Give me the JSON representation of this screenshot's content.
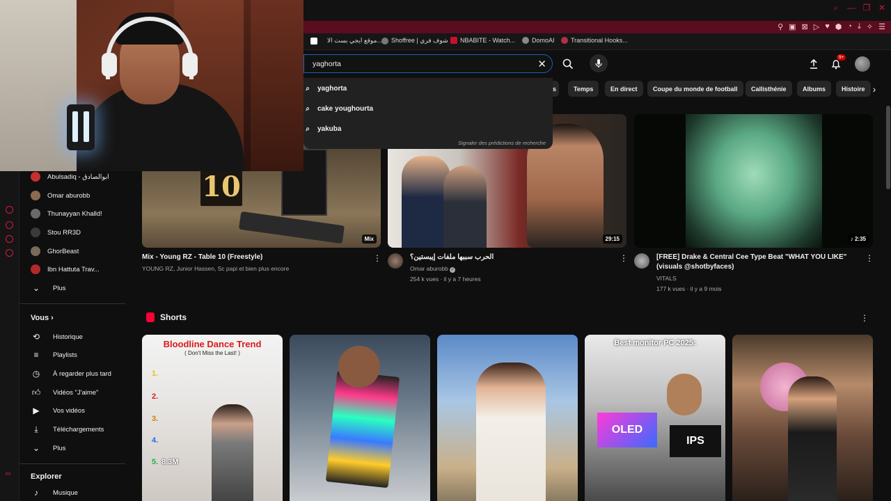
{
  "bookmarks": [
    {
      "label": "موقع ايجي بست الا..."
    },
    {
      "label": "Shoffree | شوف فري"
    },
    {
      "label": "NBABITE - Watch..."
    },
    {
      "label": "DomoAI"
    },
    {
      "label": "Transitional Hooks..."
    }
  ],
  "search": {
    "query": "yaghorta",
    "suggestions": [
      "yaghorta",
      "cake youghourta",
      "yakuba"
    ],
    "report": "Signaler des prédictions de recherche"
  },
  "header": {
    "notif_count": "9+"
  },
  "chips": [
    "Temps",
    "En direct",
    "Coupe du monde de football",
    "Callisthénie",
    "Albums",
    "Histoire"
  ],
  "chip_partial": "s",
  "subscriptions": [
    {
      "name": "Abulsadiq - ابوالصادق",
      "color": "#c43030"
    },
    {
      "name": "Omar aburobb",
      "color": "#8a6a50"
    },
    {
      "name": "Thunayyan Khalld!",
      "color": "#6a6a6a"
    },
    {
      "name": "Stou RR3D",
      "color": "#3a3a3a"
    },
    {
      "name": "GhorBeast",
      "color": "#7a6a5a"
    },
    {
      "name": "Ibn Hattuta Trav...",
      "color": "#b02a2a"
    }
  ],
  "sidebar": {
    "more": "Plus",
    "you_header": "Vous",
    "you_items": [
      "Historique",
      "Playlists",
      "À regarder plus tard",
      "Vidéos \"J'aime\"",
      "Vos vidéos",
      "Téléchargements",
      "Plus"
    ],
    "explore_header": "Explorer",
    "explore_items": [
      "Musique"
    ]
  },
  "videos": [
    {
      "title": "Mix - Young RZ - Table 10 (Freestyle)",
      "meta1": "YOUNG RZ, Junior Hassen, Sc papi et bien plus encore",
      "meta2": "",
      "badge": "Mix",
      "overlay": "10"
    },
    {
      "title": "الحرب سببها ملفات إيبستين؟",
      "meta1": "Omar aburobb",
      "meta2": "254 k vues · il y a 7 heures",
      "badge": "29:15"
    },
    {
      "title": "[FREE] Drake & Central Cee Type Beat \"WHAT YOU LIKE\" (visuals @shotbyfaces)",
      "meta1": "VITALS",
      "meta2": "177 k vues · il y a 9 mois",
      "badge": "2:35"
    }
  ],
  "shorts": {
    "header": "Shorts",
    "items": [
      {
        "title": "Bloodline Dance Trend",
        "subtitle": "( Don't Miss the Last! )",
        "ranks": [
          "1.",
          "2.",
          "3.",
          "4.",
          "5."
        ],
        "count": "8.3M"
      },
      {
        "title": ""
      },
      {
        "title": ""
      },
      {
        "title": "Best monitor PC 2025:",
        "label1": "OLED",
        "label2": "IPS"
      },
      {
        "title": ""
      }
    ]
  }
}
